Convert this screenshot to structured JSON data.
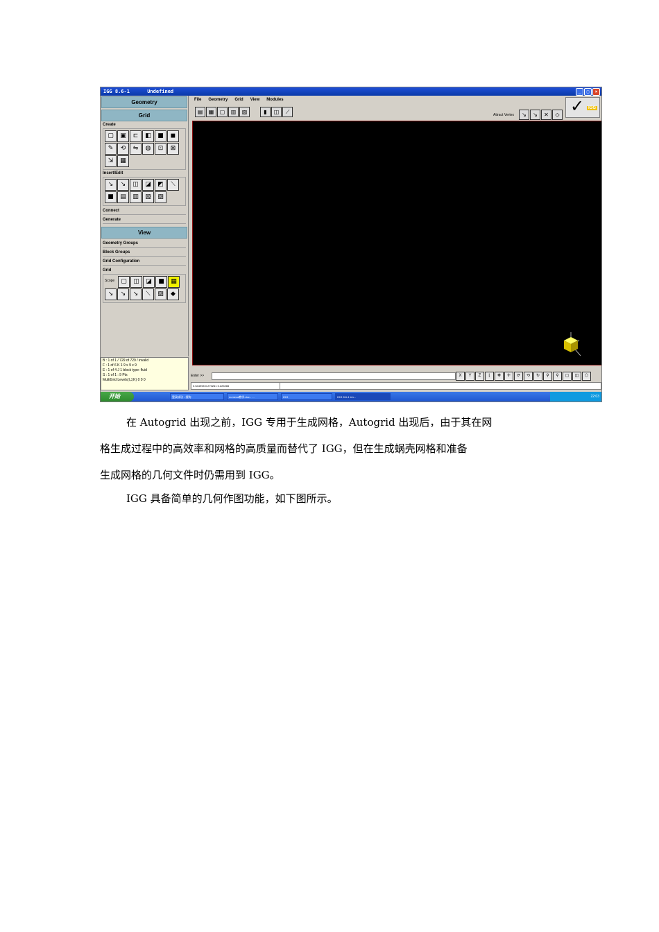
{
  "window": {
    "title": "IGG 8.6-1      Undefined"
  },
  "left_panel": {
    "geometry": "Geometry",
    "grid": "Grid",
    "create": "Create",
    "insert_edit": "Insert/Edit",
    "connect": "Connect",
    "generate": "Generate",
    "view": "View",
    "geometry_groups": "Geometry Groups",
    "block_groups": "Block Groups",
    "grid_configuration": "Grid Configuration",
    "grid_sub": "Grid",
    "scope": "Scope"
  },
  "status": {
    "line1": "B : 1 of 1 / 729 of 729 / invalid",
    "line2": "F : 1 of 6  K   1   9 x 9 x 9",
    "line3": "E : 1 of 4  J   1   block type: fluid",
    "line4": "S : 1 of 1 : 9 Pts",
    "line5": "MultiGrid Levels(I,J,K) 0 0 0"
  },
  "menu": [
    "File",
    "Geometry",
    "Grid",
    "View",
    "Modules"
  ],
  "attract_label": "Attract Vertex",
  "logo_text": "IGG",
  "cmd": {
    "enter": "Enter >>",
    "coords": "0.544998  0.270261  0.225265"
  },
  "view_buttons": [
    "X",
    "Y",
    "Z"
  ],
  "taskbar": {
    "start": "开始",
    "tasks": [
      "登录成功 - 搜狗",
      "numeca教学.doc - ...",
      "IGG",
      "IGG 8.6-1    Un..."
    ],
    "clock": "22:03"
  },
  "para1": {
    "l1": "在 Autogrid 出现之前，IGG 专用于生成网格，Autogrid 出现后，由于其在网",
    "l2": "格生成过程中的高效率和网格的高质量而替代了 IGG，但在生成蜗壳网格和准备",
    "l3": "生成网格的几何文件时仍需用到 IGG。"
  },
  "para2": "IGG 具备简单的几何作图功能，如下图所示。"
}
